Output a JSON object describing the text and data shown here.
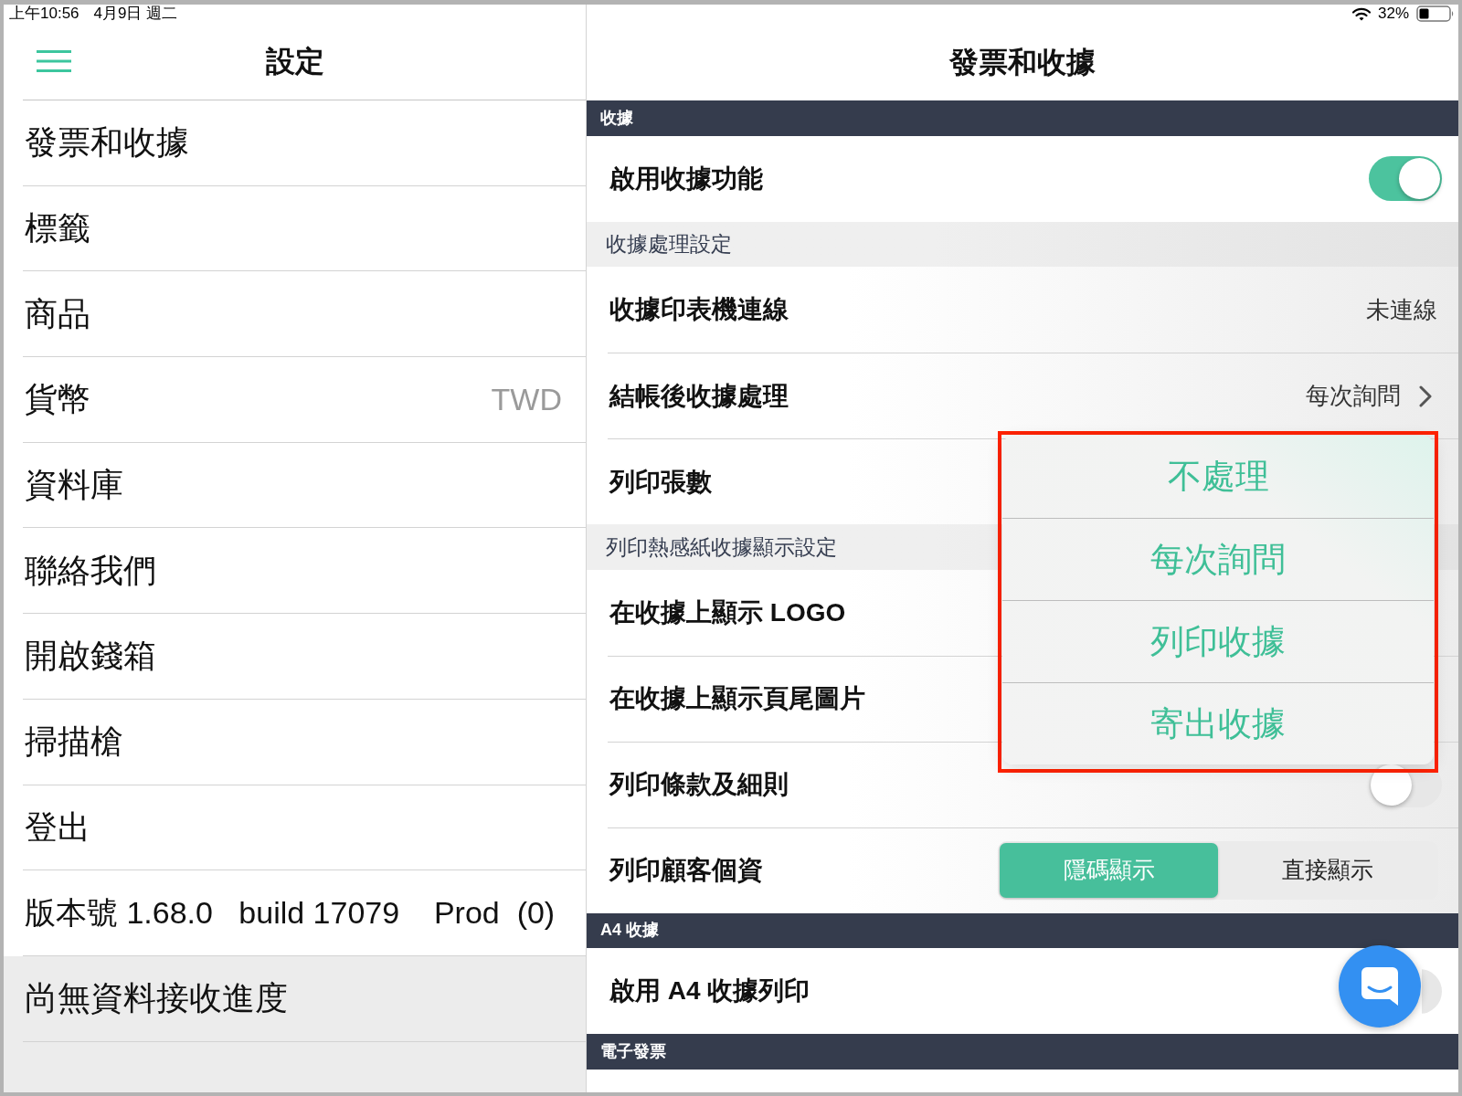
{
  "status_bar": {
    "time": "上午10:56",
    "date": "4月9日 週二",
    "battery": "32%"
  },
  "sidebar": {
    "title": "設定",
    "items": [
      {
        "kind": "nav",
        "label": "發票和收據"
      },
      {
        "kind": "nav",
        "label": "標籤"
      },
      {
        "kind": "nav",
        "label": "商品"
      },
      {
        "kind": "nav",
        "label": "貨幣",
        "value": "TWD"
      },
      {
        "kind": "nav",
        "label": "資料庫"
      },
      {
        "kind": "nav",
        "label": "聯絡我們"
      },
      {
        "kind": "nav",
        "label": "開啟錢箱"
      },
      {
        "kind": "nav",
        "label": "掃描槍"
      },
      {
        "kind": "nav",
        "label": "登出"
      },
      {
        "kind": "info",
        "label": "版本號 1.68.0   build 17079    Prod  (0)"
      },
      {
        "kind": "status",
        "label": "尚無資料接收進度"
      }
    ]
  },
  "detail": {
    "title": "發票和收據",
    "groups": [
      {
        "kind": "section",
        "title": "收據",
        "rows": [
          {
            "kind": "toggle",
            "label": "啟用收據功能",
            "on": true
          }
        ]
      },
      {
        "kind": "subsection",
        "title": "收據處理設定",
        "rows": [
          {
            "kind": "value",
            "label": "收據印表機連線",
            "value": "未連線"
          },
          {
            "kind": "disclosure",
            "label": "結帳後收據處理",
            "value": "每次詢問"
          },
          {
            "kind": "plain",
            "label": "列印張數"
          }
        ]
      },
      {
        "kind": "subsection",
        "title": "列印熱感紙收據顯示設定",
        "rows": [
          {
            "kind": "plain",
            "label": "在收據上顯示 LOGO"
          },
          {
            "kind": "plain",
            "label": "在收據上顯示頁尾圖片"
          },
          {
            "kind": "toggle",
            "label": "列印條款及細則",
            "on": false
          },
          {
            "kind": "segmented",
            "label": "列印顧客個資",
            "options": [
              {
                "label": "隱碼顯示",
                "selected": true
              },
              {
                "label": "直接顯示",
                "selected": false
              }
            ]
          }
        ]
      },
      {
        "kind": "section",
        "title": "A4 收據",
        "rows": [
          {
            "kind": "toggle",
            "label": "啟用 A4 收據列印",
            "on": false,
            "covered": true
          }
        ]
      },
      {
        "kind": "section",
        "title": "電子發票"
      }
    ]
  },
  "popup": {
    "highlighted": true,
    "options": [
      "不處理",
      "每次詢問",
      "列印收據",
      "寄出收據"
    ]
  }
}
